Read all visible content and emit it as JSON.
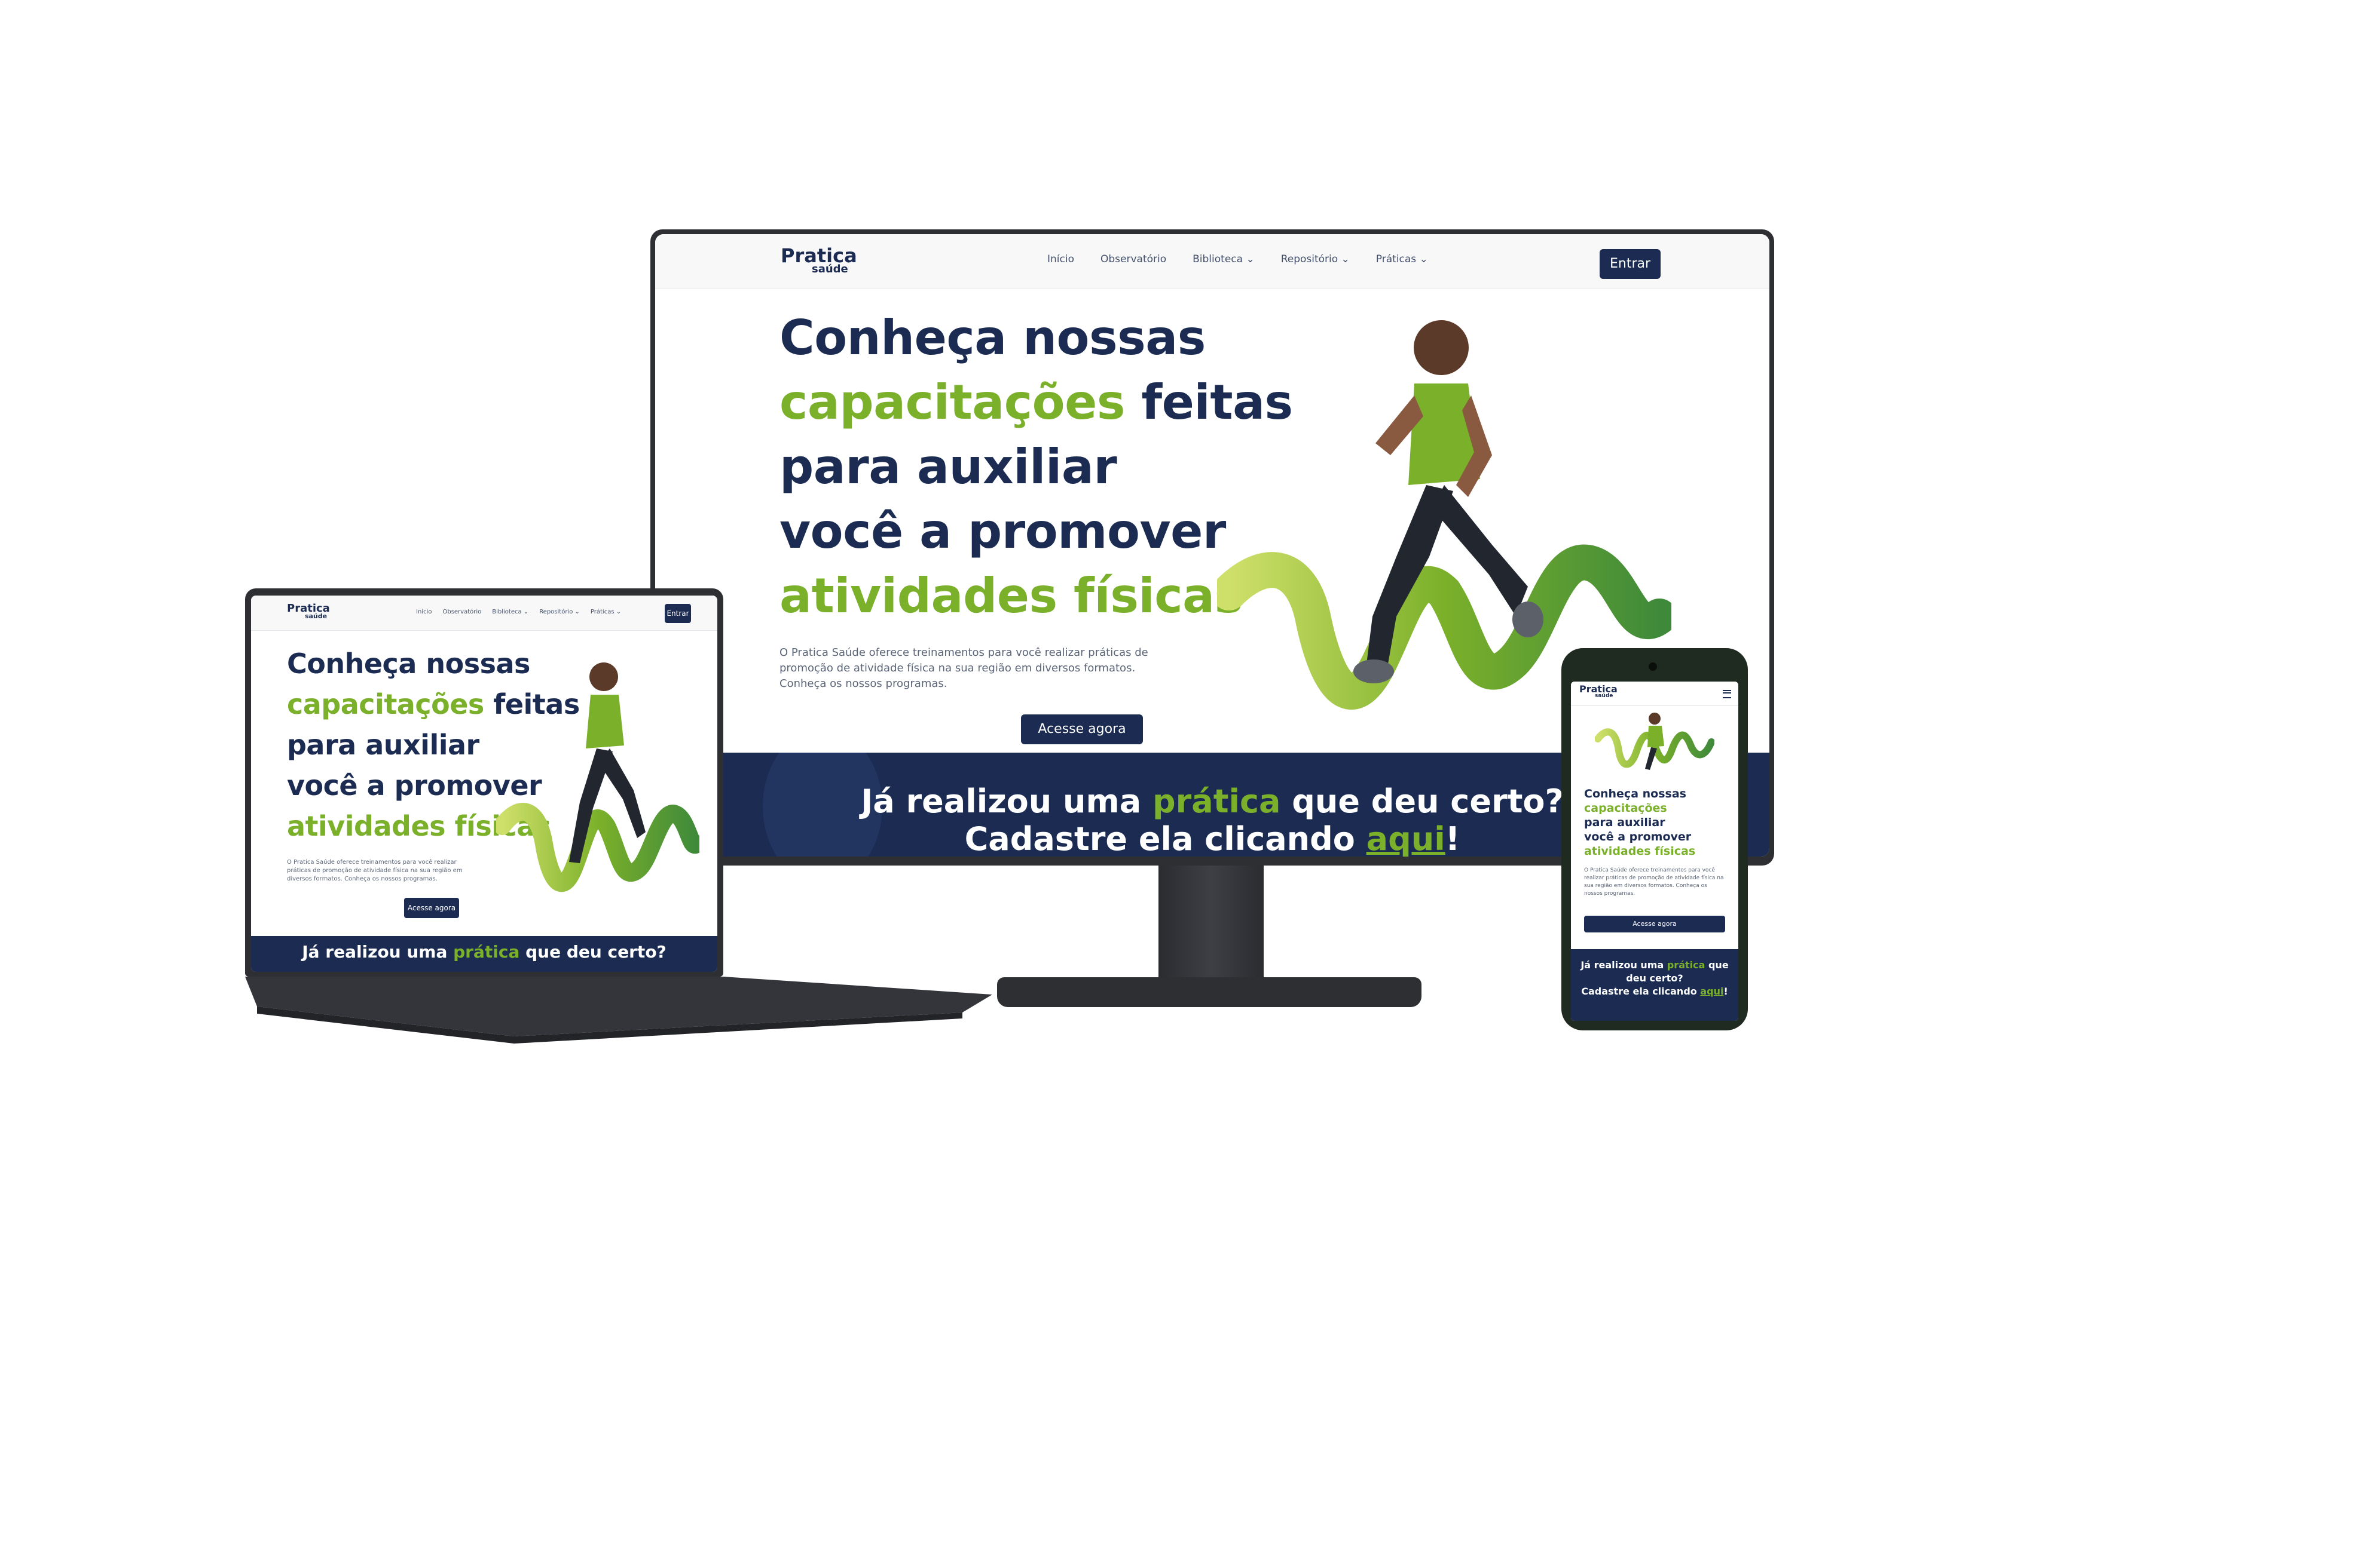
{
  "brand": {
    "name_top": "Pratica",
    "name_bottom": "saúde",
    "navy": "#1b2b52",
    "green": "#7bb02a"
  },
  "nav": {
    "items": [
      "Início",
      "Observatório",
      "Biblioteca ⌄",
      "Repositório ⌄",
      "Práticas ⌄"
    ],
    "login": "Entrar"
  },
  "hero": {
    "line1": "Conheça nossas",
    "line2_green": "capacitações",
    "line2_rest": " feitas",
    "line3": "para auxiliar",
    "line4": "você a promover",
    "line5_green": "atividades físicas",
    "paragraph": "O Pratica Saúde oferece treinamentos para você realizar práticas de promoção de atividade física na sua região em diversos formatos. Conheça os nossos programas.",
    "cta": "Acesse agora"
  },
  "band": {
    "part1": "Já realizou uma ",
    "part1_green": "prática",
    "part1_rest": " que deu certo?",
    "part2": "Cadastre ela clicando ",
    "part2_link": "aqui",
    "part2_end": "!"
  },
  "mobile": {
    "menu_icon": "hamburger-icon"
  }
}
